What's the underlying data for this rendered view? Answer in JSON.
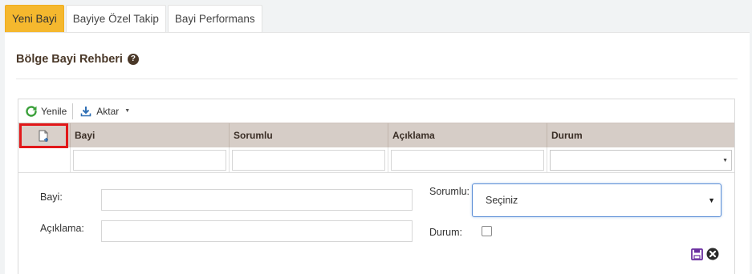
{
  "tabs": [
    {
      "label": "Yeni Bayi",
      "active": true
    },
    {
      "label": "Bayiye Özel Takip",
      "active": false
    },
    {
      "label": "Bayi Performans",
      "active": false
    }
  ],
  "panel": {
    "title": "Bölge Bayi Rehberi"
  },
  "toolbar": {
    "refresh_label": "Yenile",
    "export_label": "Aktar"
  },
  "grid": {
    "columns": [
      "Bayi",
      "Sorumlu",
      "Açıklama",
      "Durum"
    ]
  },
  "form": {
    "bayi_label": "Bayi:",
    "aciklama_label": "Açıklama:",
    "sorumlu_label": "Sorumlu:",
    "sorumlu_value": "Seçiniz",
    "durum_label": "Durum:",
    "durum_checked": false
  },
  "colors": {
    "active_tab": "#f5b82e",
    "header_bg": "#d6cdc7",
    "highlight_border": "#e2181a",
    "save_icon": "#6b2fa0"
  }
}
